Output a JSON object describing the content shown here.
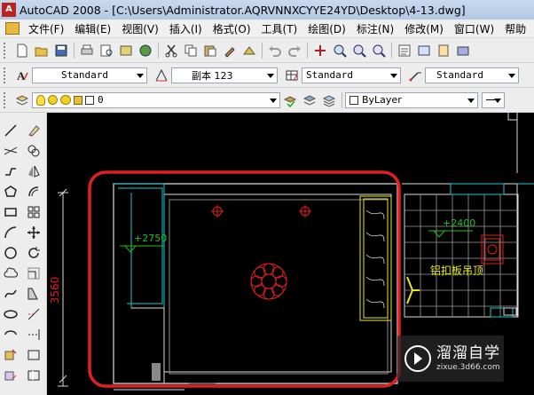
{
  "window": {
    "title": "AutoCAD 2008 - [C:\\Users\\Administrator.AQRVNNXCYYE24YD\\Desktop\\4-13.dwg]"
  },
  "menu": {
    "items": [
      "文件(F)",
      "编辑(E)",
      "视图(V)",
      "插入(I)",
      "格式(O)",
      "工具(T)",
      "绘图(D)",
      "标注(N)",
      "修改(M)",
      "窗口(W)",
      "帮助"
    ]
  },
  "styles_toolbar": {
    "text_style": "Standard",
    "dim_style": "副本 123",
    "table_style": "Standard",
    "mleader_style": "Standard"
  },
  "layers_toolbar": {
    "layer_name": "0",
    "color_control": "ByLayer"
  },
  "drawing": {
    "left_elevation": "+2750",
    "right_elevation": "+2400",
    "dimension": "3560",
    "annotation": "铝扣板吊顶"
  },
  "watermark": {
    "title": "溜溜自学",
    "url": "zixue.3d66.com"
  },
  "colors": {
    "accent_red": "#e02020",
    "cad_cyan": "#20c8c8",
    "cad_green": "#20c020",
    "cad_yellow": "#e8e820",
    "cad_white": "#dcdcdc"
  }
}
